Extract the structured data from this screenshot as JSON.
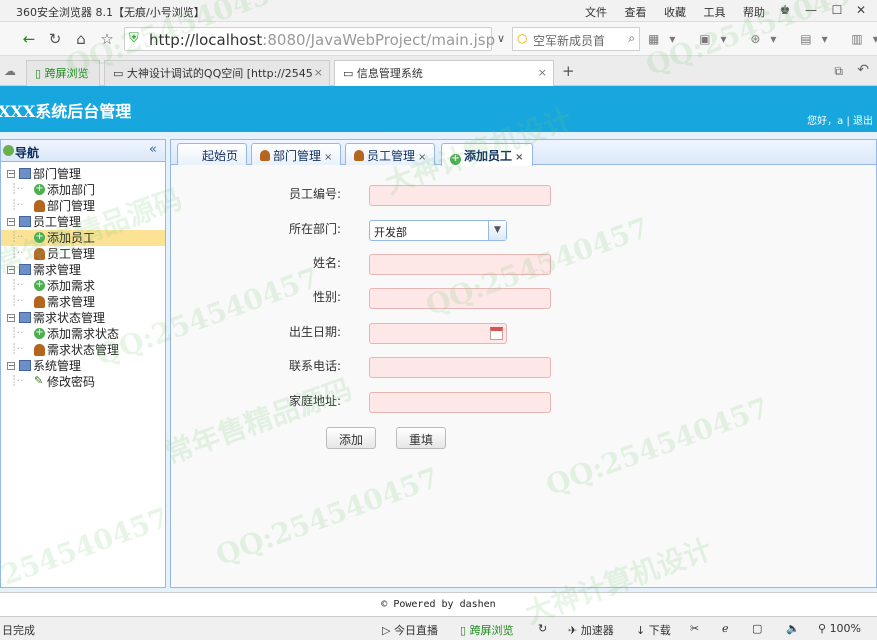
{
  "browser": {
    "title": "360安全浏览器 8.1【无痕/小号浏览】",
    "menus": [
      "文件",
      "查看",
      "收藏",
      "工具",
      "帮助"
    ],
    "url_host": "http://localhost",
    "url_rest": ":8080/JavaWebProject/main.jsp",
    "search_text": "空军新成员首",
    "tabs": [
      "跨屏浏览",
      "大神设计调试的QQ空间 [http://2545",
      "信息管理系统"
    ]
  },
  "app": {
    "title": "XXX系统后台管理",
    "user_text": "您好，a | 退出",
    "nav_title": "导航",
    "collapse_icon": "«",
    "tree": [
      {
        "label": "部门管理",
        "type": "folder",
        "level": 0
      },
      {
        "label": "添加部门",
        "type": "add",
        "level": 1
      },
      {
        "label": "部门管理",
        "type": "user",
        "level": 1
      },
      {
        "label": "员工管理",
        "type": "folder",
        "level": 0
      },
      {
        "label": "添加员工",
        "type": "add",
        "level": 1,
        "selected": true
      },
      {
        "label": "员工管理",
        "type": "user",
        "level": 1
      },
      {
        "label": "需求管理",
        "type": "folder",
        "level": 0
      },
      {
        "label": "添加需求",
        "type": "add",
        "level": 1
      },
      {
        "label": "需求管理",
        "type": "user",
        "level": 1
      },
      {
        "label": "需求状态管理",
        "type": "folder",
        "level": 0
      },
      {
        "label": "添加需求状态",
        "type": "add",
        "level": 1
      },
      {
        "label": "需求状态管理",
        "type": "user",
        "level": 1
      },
      {
        "label": "系统管理",
        "type": "folder",
        "level": 0
      },
      {
        "label": "修改密码",
        "type": "key",
        "level": 1
      }
    ],
    "content_tabs": [
      {
        "label": "起始页",
        "closable": false
      },
      {
        "label": "部门管理",
        "closable": true
      },
      {
        "label": "员工管理",
        "closable": true
      },
      {
        "label": "添加员工",
        "closable": true,
        "active": true
      }
    ],
    "form": {
      "employee_no_label": "员工编号:",
      "employee_no_value": "",
      "department_label": "所在部门:",
      "department_value": "开发部",
      "name_label": "姓名:",
      "name_value": "",
      "gender_label": "性别:",
      "gender_value": "",
      "birthday_label": "出生日期:",
      "birthday_value": "",
      "phone_label": "联系电话:",
      "phone_value": "",
      "address_label": "家庭地址:",
      "address_value": "",
      "submit_label": "添加",
      "reset_label": "重填"
    },
    "footer": "© Powered by dashen"
  },
  "statusbar": {
    "left": "日完成",
    "items": [
      "今日直播",
      "跨屏浏览",
      "加速器",
      "下载",
      "100%"
    ]
  },
  "watermarks": [
    "QQ:254540457",
    "大神计算机设计",
    "常年售精品源码"
  ],
  "colors": {
    "header": "#17a7de",
    "selected": "#fbe295",
    "required_field": "#fde7e7"
  }
}
